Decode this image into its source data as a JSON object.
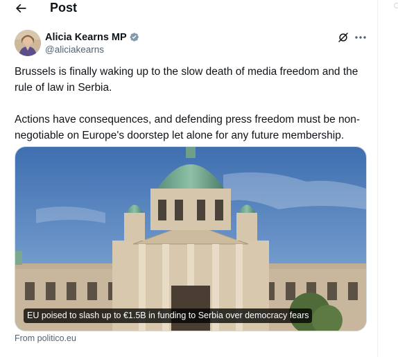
{
  "header": {
    "title": "Post"
  },
  "author": {
    "display_name": "Alicia Kearns MP",
    "handle": "@aliciakearns"
  },
  "tweet": {
    "paragraphs": [
      "Brussels is finally waking up to the slow death of media freedom and the rule of law in Serbia.",
      "Actions have consequences, and defending press freedom must be non-negotiable on Europe's doorstep let alone for any future membership."
    ]
  },
  "link_card": {
    "caption": "EU poised to slash up to €1.5B in funding to Serbia over democracy fears",
    "source": "From politico.eu"
  },
  "colors": {
    "text": "#0f1419",
    "secondary": "#536471",
    "verified": "#829aab",
    "border": "#cfd9de"
  },
  "icons": {
    "back": "arrow-left-icon",
    "verified": "verified-badge-icon",
    "grok": "grok-icon",
    "more": "more-horizontal-icon"
  }
}
